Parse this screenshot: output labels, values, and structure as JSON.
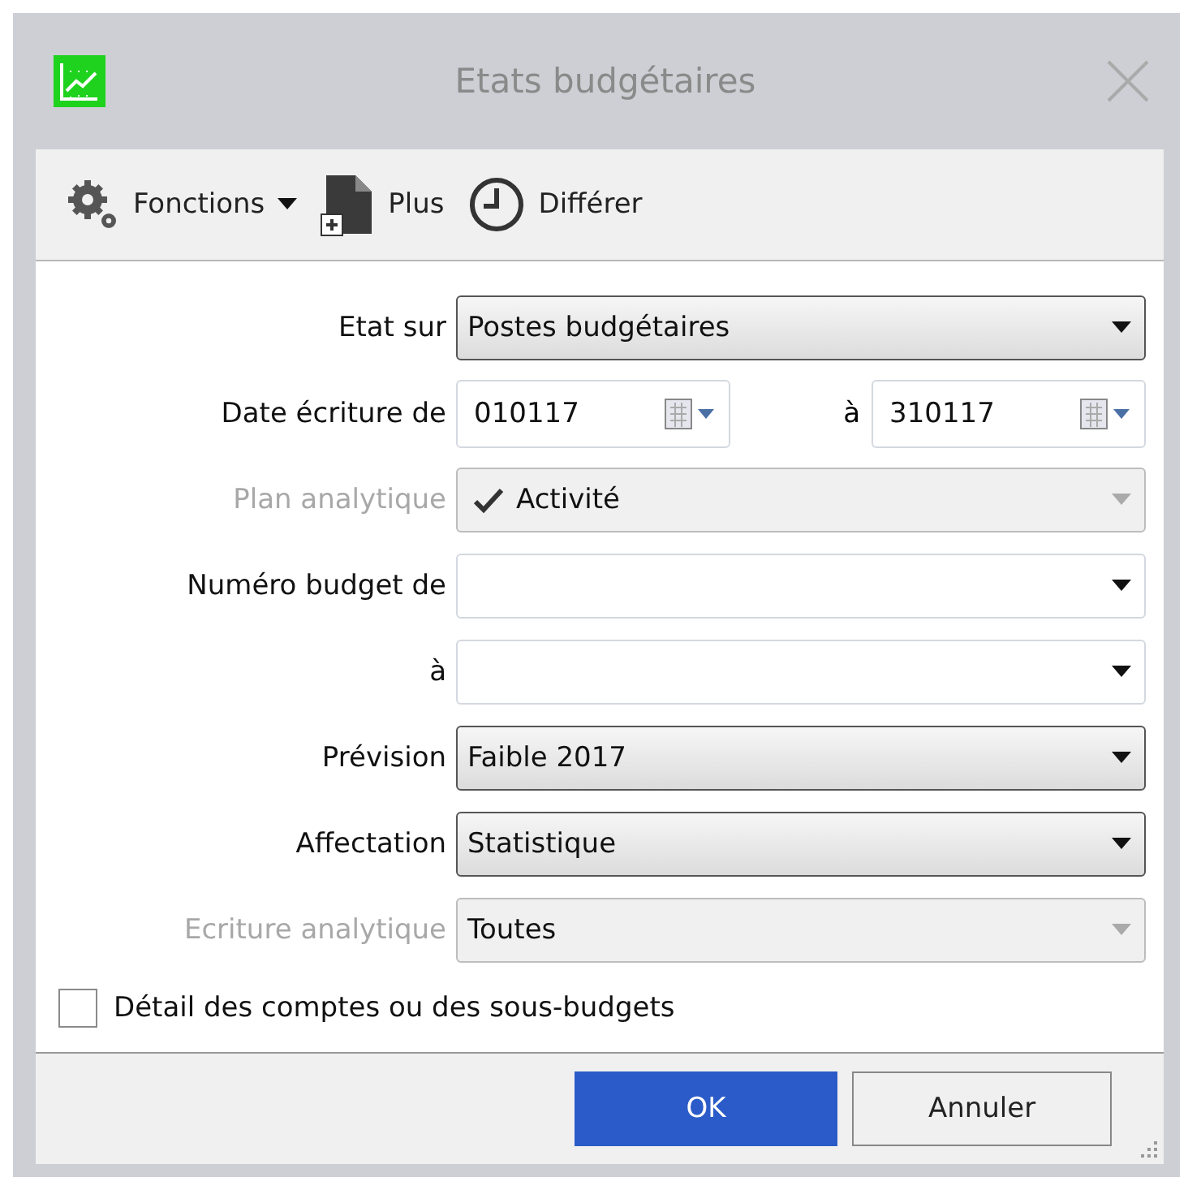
{
  "window": {
    "title": "Etats budgétaires"
  },
  "toolbar": [
    {
      "kind": "gear",
      "label": "Fonctions",
      "has_menu": true
    },
    {
      "kind": "document",
      "label": "Plus",
      "has_menu": false
    },
    {
      "kind": "clock",
      "label": "Différer",
      "has_menu": false
    }
  ],
  "fields": [
    {
      "label": "Etat sur",
      "kind": "select",
      "value": "Postes budgétaires",
      "disabled": false
    },
    {
      "label": "Date écriture de",
      "kind": "date-range",
      "value": "010117",
      "to_label": "à",
      "to_value": "310117",
      "disabled": false
    },
    {
      "label": "Plan analytique",
      "kind": "select",
      "value": "Activité",
      "ticked": true,
      "disabled": true
    },
    {
      "label": "Numéro budget de",
      "kind": "combo",
      "disabled": false
    },
    {
      "label": "à",
      "kind": "combo",
      "disabled": false
    },
    {
      "label": "Prévision",
      "kind": "select",
      "value": "Faible 2017",
      "disabled": false
    },
    {
      "label": "Affectation",
      "kind": "select",
      "value": "Statistique",
      "disabled": false
    },
    {
      "label": "Ecriture analytique",
      "kind": "select",
      "value": "Toutes",
      "disabled": true
    }
  ],
  "checkbox": {
    "label": "Détail des comptes ou des sous-budgets",
    "checked": false
  },
  "buttons": [
    {
      "label": "OK",
      "default": true
    },
    {
      "label": "Annuler",
      "default": false
    }
  ]
}
